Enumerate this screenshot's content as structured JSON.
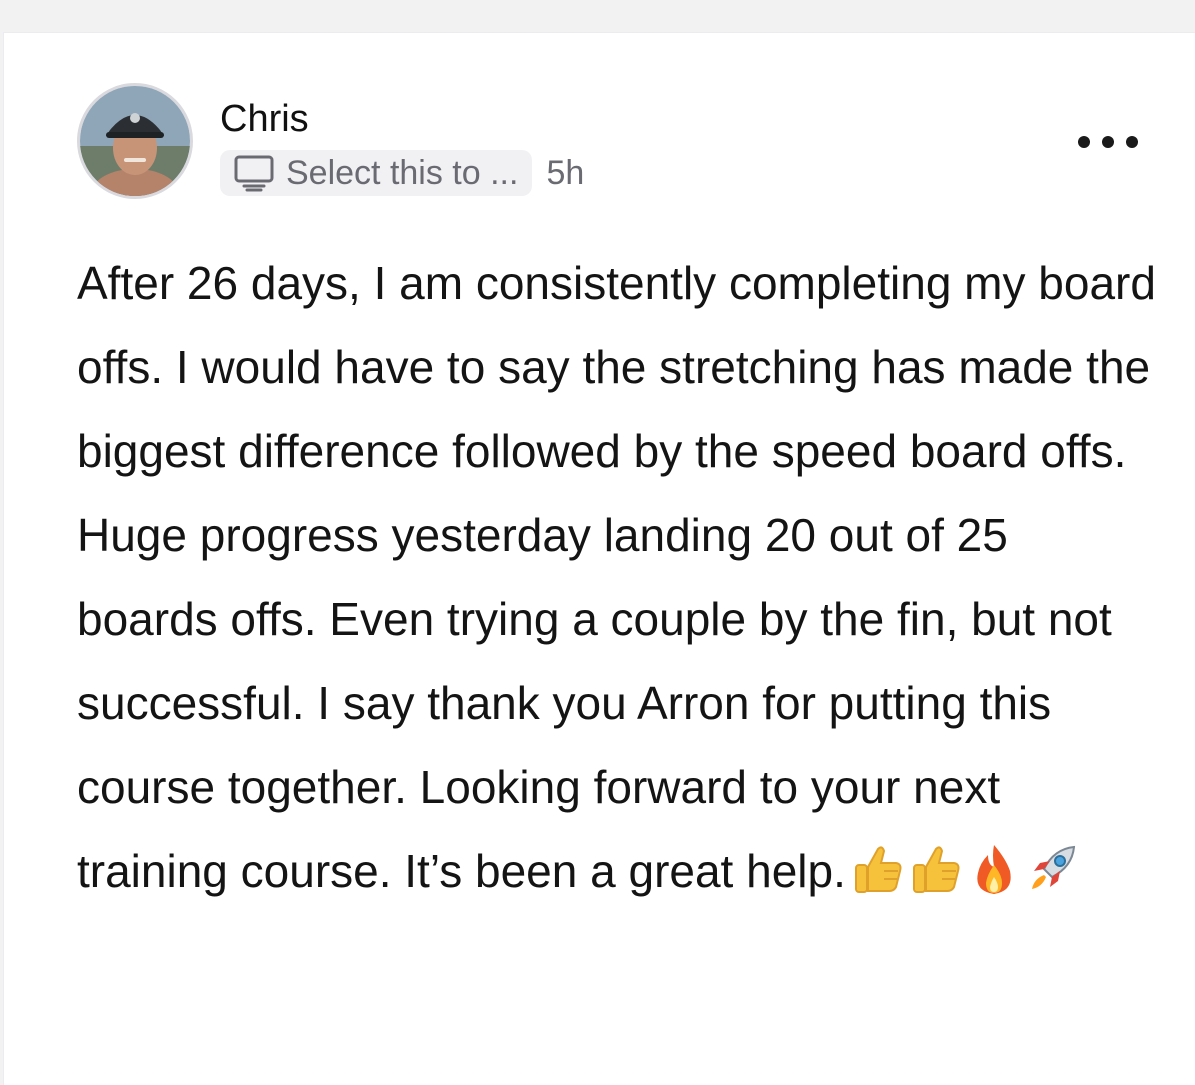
{
  "post": {
    "author": "Chris",
    "context_label": "Select this to ...",
    "timestamp": "5h",
    "body": "After 26 days, I am consistently completing my board offs. I would have to say the stretching has made the biggest difference followed by the speed board offs. Huge progress yesterday landing 20 out of 25 boards offs. Even trying a couple by the fin, but not successful. I say thank you Arron for putting this course together. Looking forward to your next training course. It’s been a great help.",
    "emojis": [
      "thumbs-up-emoji",
      "thumbs-up-emoji",
      "fire-emoji",
      "rocket-emoji"
    ]
  },
  "icons": {
    "context": "monitor-icon",
    "more": "more-options-icon"
  },
  "colors": {
    "text_primary": "#141414",
    "text_secondary": "#6a6a72",
    "chip_bg": "#f1f1f4",
    "card_bg": "#ffffff"
  }
}
